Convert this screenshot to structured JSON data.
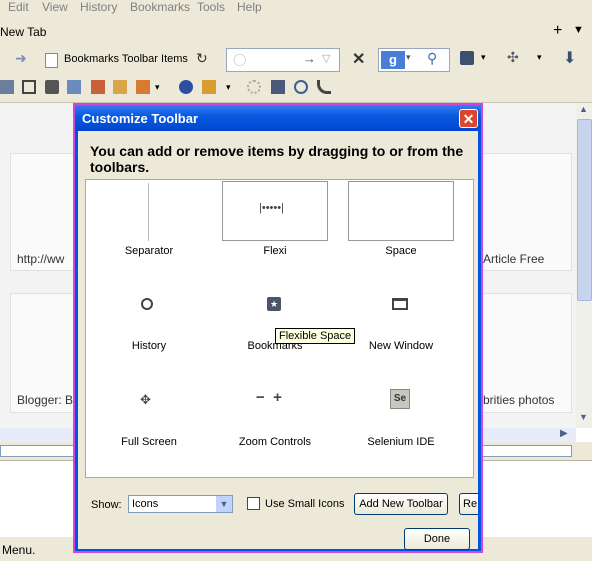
{
  "menu": [
    "Edit",
    "View",
    "History",
    "Bookmarks",
    "Tools",
    "Help"
  ],
  "tab": {
    "title": "New Tab",
    "new_tab_symbol": "+",
    "list_symbol": "▼"
  },
  "navbar": {
    "bookmark_item": "Bookmarks Toolbar Items",
    "reload_icon": "reload-icon",
    "stop_symbol": "✕"
  },
  "page": {
    "tiles": [
      {
        "caption_left": "http://ww",
        "caption_right": "Article Free"
      },
      {
        "caption_left": "Blogger: B",
        "caption_right": "brities photos"
      }
    ]
  },
  "status": {
    "text": "Menu."
  },
  "dialog": {
    "title": "Customize Toolbar",
    "close_symbol": "✕",
    "instruction": "You can add or remove items by dragging to or from the toolbars.",
    "items": [
      {
        "label": "Separator",
        "icon": "separator-icon"
      },
      {
        "label": "Flexible Space",
        "visible_label": "Flexi",
        "icon": "flexible-space-icon"
      },
      {
        "label": "Space",
        "icon": "space-icon"
      },
      {
        "label": "History",
        "icon": "clock-icon"
      },
      {
        "label": "Bookmarks",
        "icon": "star-icon"
      },
      {
        "label": "New Window",
        "icon": "window-icon"
      },
      {
        "label": "Full Screen",
        "icon": "fullscreen-icon"
      },
      {
        "label": "Zoom Controls",
        "icon": "zoom-icon"
      },
      {
        "label": "Selenium IDE",
        "icon": "selenium-icon"
      }
    ],
    "tooltip": "Flexible Space",
    "show_label": "Show:",
    "show_value": "Icons",
    "small_icons_label": "Use Small Icons",
    "small_icons_checked": false,
    "add_toolbar_label": "Add New Toolbar",
    "restore_label": "Re",
    "done_label": "Done"
  },
  "colors": {
    "title_bar": "#0054e3",
    "dialog_border": "#d048d8",
    "close_button": "#d9482c",
    "chrome": "#ece9d8"
  }
}
